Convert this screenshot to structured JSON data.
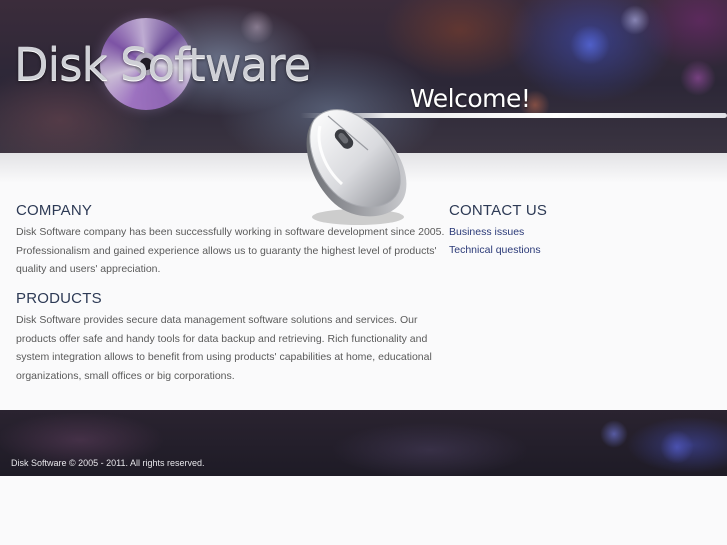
{
  "header": {
    "logo_text": "Disk Software",
    "welcome": "Welcome!"
  },
  "company": {
    "title": "COMPANY",
    "lines": [
      "Disk Software company has been successfully working in software development since 2005.",
      "Professionalism and gained experience allows us to guaranty the highest level of products'",
      "quality and users' appreciation."
    ]
  },
  "products": {
    "title": "PRODUCTS",
    "lines": [
      "Disk Software provides secure data management software solutions and services. Our",
      "products offer safe and handy tools for data backup and retrieving. Rich functionality and",
      "system integration allows to benefit from using products' capabilities at home, educational",
      "organizations, small offices or big corporations."
    ]
  },
  "contact": {
    "title": "CONTACT US",
    "links": [
      "Business issues",
      "Technical questions"
    ]
  },
  "footer": {
    "copyright": "Disk Software © 2005 - 2011. All rights reserved."
  },
  "colors": {
    "heading": "#2d3a55",
    "link": "#2b3a78",
    "body_text": "#5a5a5a"
  },
  "icons": [
    "disc-logo-icon",
    "computer-mouse-icon"
  ]
}
